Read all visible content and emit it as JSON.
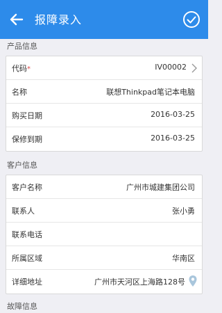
{
  "header": {
    "title": "报障录入"
  },
  "product": {
    "section_title": "产品信息",
    "code_label": "代码",
    "code_required_mark": "*",
    "code_value": "IV00002",
    "name_label": "名称",
    "name_value": "联想Thinkpad笔记本电脑",
    "purchase_label": "购买日期",
    "purchase_value": "2016-03-25",
    "warranty_label": "保修到期",
    "warranty_value": "2016-03-25"
  },
  "customer": {
    "section_title": "客户信息",
    "name_label": "客户名称",
    "name_value": "广州市城建集团公司",
    "contact_label": "联系人",
    "contact_value": "张小勇",
    "phone_label": "联系电话",
    "phone_value": "",
    "region_label": "所属区域",
    "region_value": "华南区",
    "address_label": "详细地址",
    "address_value": "广州市天河区上海路128号"
  },
  "fault": {
    "section_title": "故障信息"
  },
  "colors": {
    "accent": "#2d8bea",
    "required": "#e04b4b",
    "background": "#efeff4"
  }
}
